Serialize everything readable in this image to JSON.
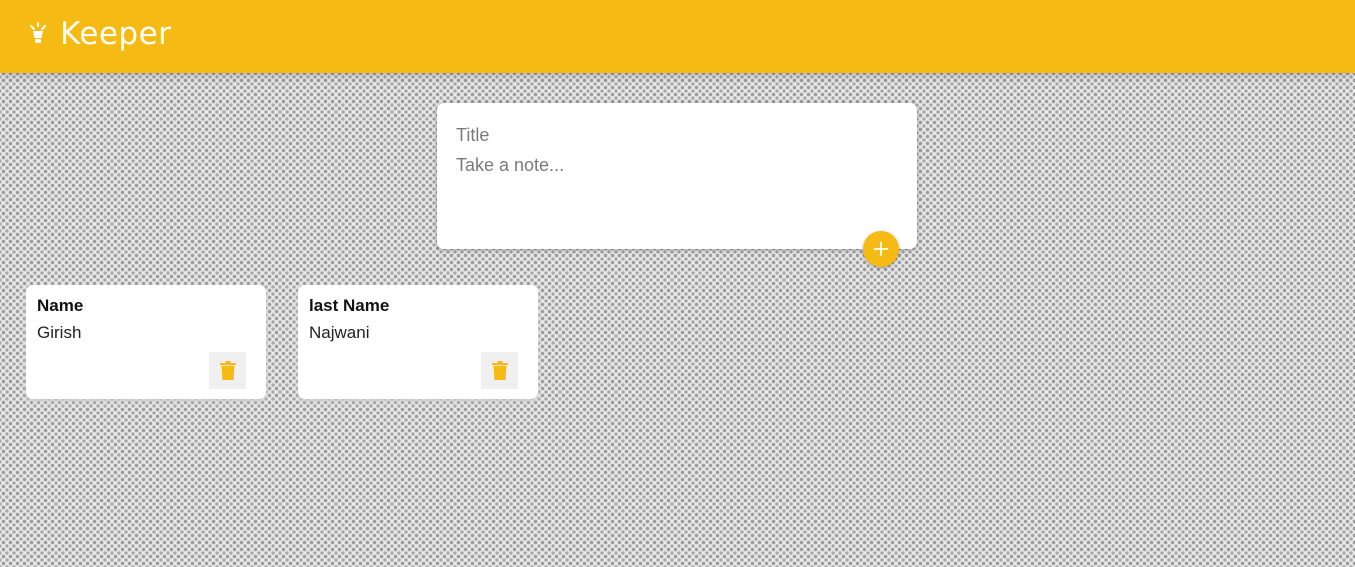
{
  "header": {
    "app_title": "Keeper",
    "logo_icon": "lightbulb-icon",
    "background_color": "#f5ba13"
  },
  "create_area": {
    "title_placeholder": "Title",
    "content_placeholder": "Take a note...",
    "add_icon": "plus-icon",
    "accent_color": "#f5ba13"
  },
  "notes": [
    {
      "title": "Name",
      "content": "Girish",
      "delete_icon": "trash-icon"
    },
    {
      "title": "last Name",
      "content": "Najwani",
      "delete_icon": "trash-icon"
    }
  ]
}
